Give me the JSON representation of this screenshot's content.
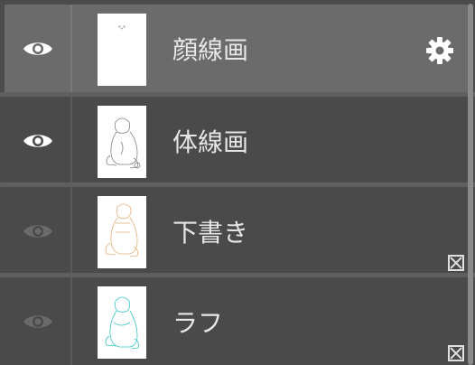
{
  "layers": [
    {
      "name": "顔線画",
      "selected": true,
      "visible": true,
      "line_color": "#9a9a9a",
      "settings_icon": "gear-icon",
      "mask_icon": null
    },
    {
      "name": "体線画",
      "selected": false,
      "visible": true,
      "line_color": "#808080",
      "settings_icon": null,
      "mask_icon": null
    },
    {
      "name": "下書き",
      "selected": false,
      "visible": false,
      "line_color": "#e2b07a",
      "settings_icon": null,
      "mask_icon": "layer-mask-icon"
    },
    {
      "name": "ラフ",
      "selected": false,
      "visible": false,
      "line_color": "#37c6c6",
      "settings_icon": null,
      "mask_icon": "layer-mask-icon"
    }
  ],
  "colors": {
    "selected_row": "#6b6b6b",
    "row": "#4a4a4a",
    "eye_visible": "#ffffff",
    "eye_hidden": "#6a6a6a"
  }
}
